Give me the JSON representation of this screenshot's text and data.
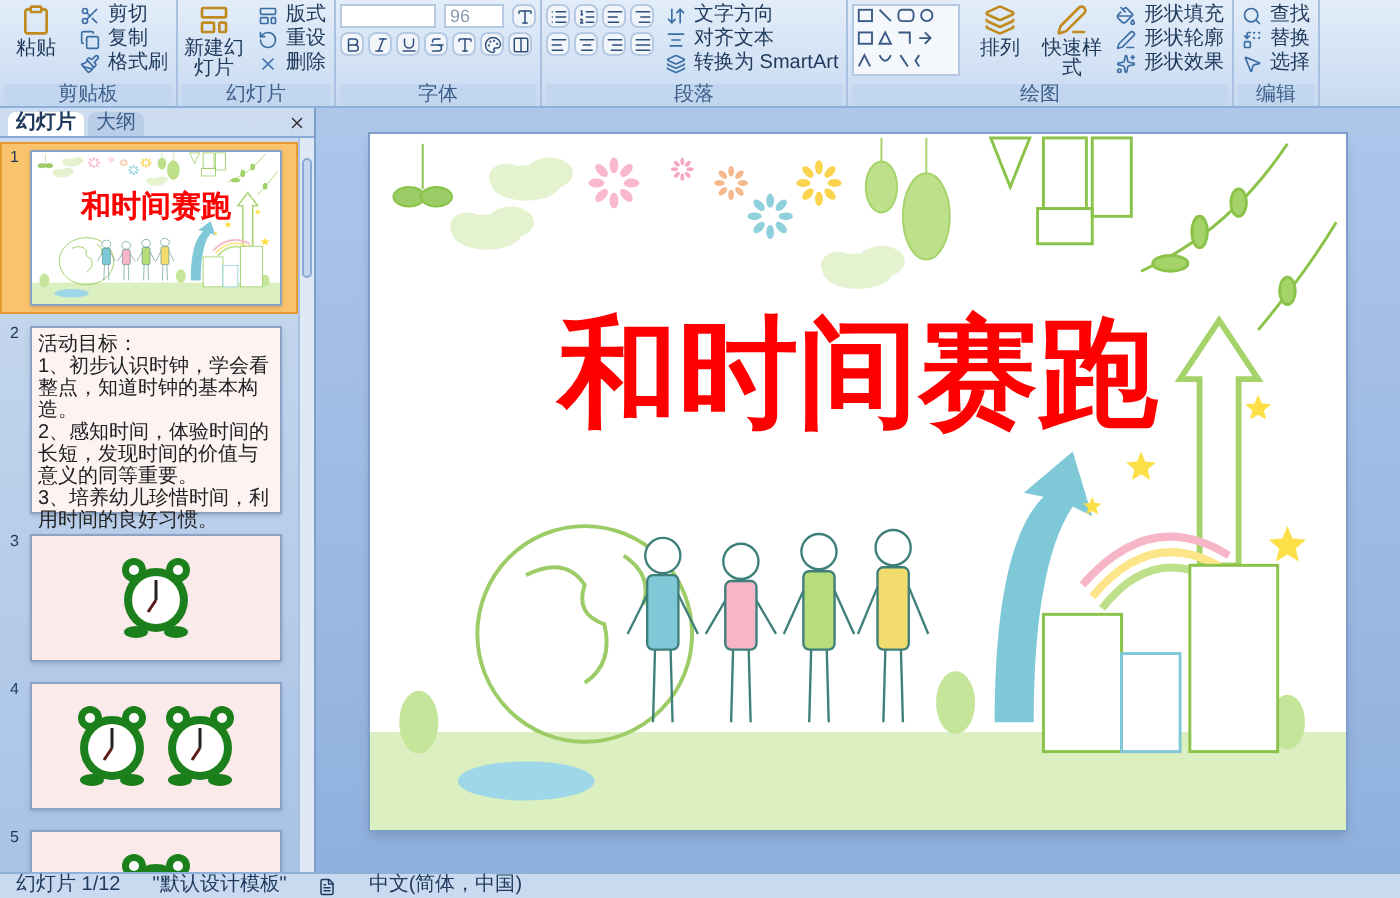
{
  "ribbon": {
    "groups": [
      {
        "kind": "clipboard",
        "label": "剪贴板",
        "large": "粘贴",
        "small": [
          "剪切",
          "复制",
          "格式刷"
        ]
      },
      {
        "kind": "slides",
        "label": "幻灯片",
        "large": "新建幻灯片",
        "small": [
          "版式",
          "重设",
          "删除"
        ]
      },
      {
        "kind": "font",
        "label": "字体",
        "font_size": "96"
      },
      {
        "kind": "paragraph",
        "label": "段落",
        "small": [
          "文字方向",
          "对齐文本",
          "转换为 SmartArt"
        ]
      },
      {
        "kind": "drawing",
        "label": "绘图",
        "large": "排列",
        "medium": "快速样式",
        "small": [
          "形状填充",
          "形状轮廓",
          "形状效果"
        ]
      },
      {
        "kind": "editing",
        "label": "编辑",
        "small": [
          "查找",
          "替换",
          "选择"
        ]
      }
    ]
  },
  "panel": {
    "tabs": [
      {
        "label": "幻灯片",
        "selected": true
      },
      {
        "label": "大纲",
        "selected": false
      }
    ]
  },
  "thumbnails": [
    {
      "number": "1",
      "selected": true,
      "kind": "title",
      "title": "和时间赛跑"
    },
    {
      "number": "2",
      "selected": false,
      "kind": "text",
      "lines": [
        "活动目标：",
        "1、初步认识时钟，学会看整点，知道时钟的基本构造。",
        "2、感知时间，体验时间的长短，发现时间的价值与意义的同等重要。",
        "3、培养幼儿珍惜时间，利用时间的良好习惯。"
      ]
    },
    {
      "number": "3",
      "selected": false,
      "kind": "one-clock"
    },
    {
      "number": "4",
      "selected": false,
      "kind": "two-clocks"
    },
    {
      "number": "5",
      "selected": false,
      "kind": "one-clock"
    }
  ],
  "slide": {
    "title": "和时间赛跑"
  },
  "status_bar": {
    "slide": "幻灯片 1/12",
    "theme": "\"默认设计模板\"",
    "language": "中文(简体，中国)"
  }
}
